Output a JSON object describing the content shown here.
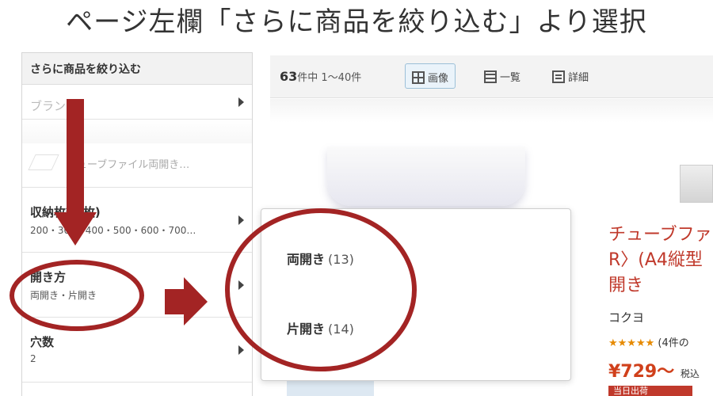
{
  "instruction_title": "ページ左欄「さらに商品を絞り込む」より選択",
  "sidebar": {
    "heading": "さらに商品を絞り込む",
    "brand_label": "ブランド",
    "series_label": "チューブファイル両開き…",
    "capacity": {
      "label": "収納枚数(枚)",
      "values": "200・300・400・500・600・700…"
    },
    "opening": {
      "label": "開き方",
      "values": "両開き・片開き"
    },
    "holes": {
      "label": "穴数",
      "values": "2"
    }
  },
  "toolbar": {
    "count_number": "63",
    "count_suffix": "件中 1〜40件",
    "view_image": "画像",
    "view_list": "一覧",
    "view_detail": "詳細"
  },
  "popup": {
    "options": [
      {
        "label": "両開き",
        "count": "(13)"
      },
      {
        "label": "片開き",
        "count": "(14)"
      }
    ]
  },
  "product": {
    "title_line1": "チューブファ",
    "title_line2": "R〉(A4縦型",
    "title_line3": "開き",
    "maker": "コクヨ",
    "stars": "★★★★★",
    "review_text": "(4件の",
    "price": "¥729〜",
    "tax_note": "税込",
    "badge": "当日出荷"
  },
  "colors": {
    "annotation_red": "#a32424",
    "product_title": "#c0392b",
    "price": "#d0401b"
  }
}
